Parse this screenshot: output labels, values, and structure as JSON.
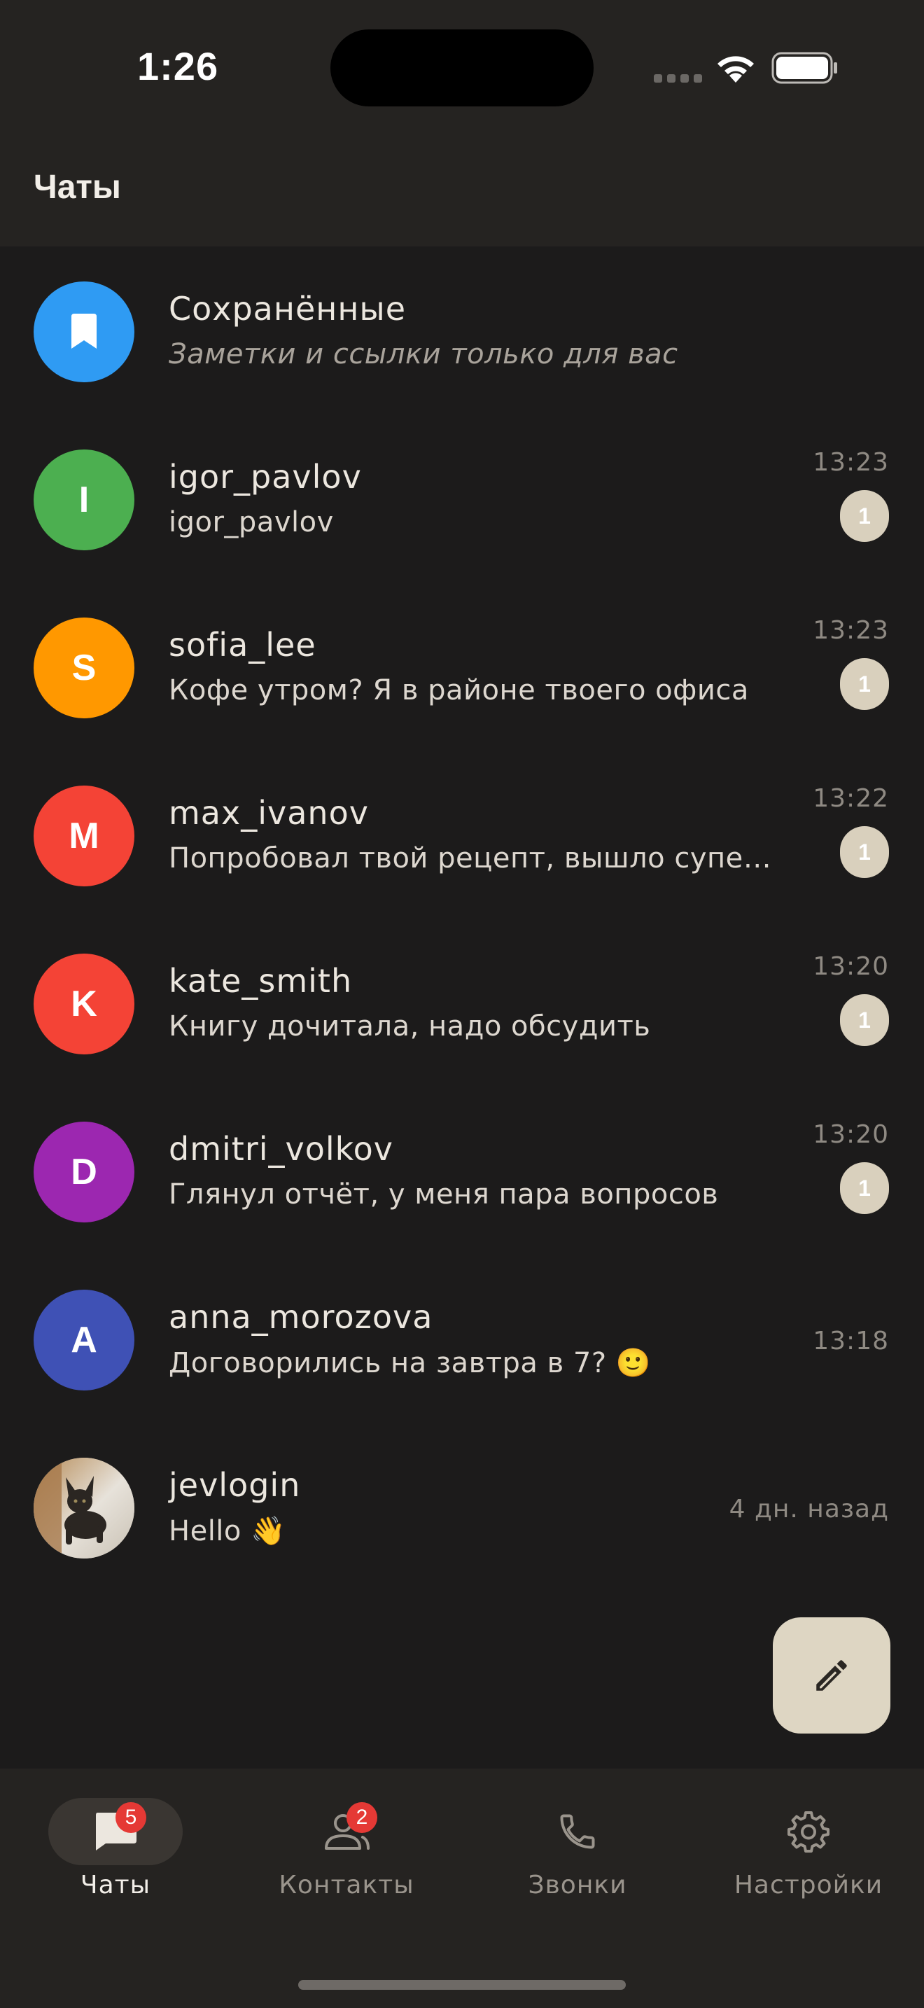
{
  "status_bar": {
    "time": "1:26"
  },
  "app_bar": {
    "title": "Чаты"
  },
  "chats": [
    {
      "name": "Сохранённые",
      "preview": "Заметки и ссылки только для вас",
      "time": "",
      "unread": "",
      "avatar": {
        "type": "icon",
        "icon": "bookmark-icon",
        "color": "#2f9bf3"
      }
    },
    {
      "name": "igor_pavlov",
      "preview": "igor_pavlov",
      "time": "13:23",
      "unread": "1",
      "avatar": {
        "type": "letter",
        "letter": "I",
        "color": "#4caf50"
      }
    },
    {
      "name": "sofia_lee",
      "preview": "Кофе утром? Я в районе твоего офиса",
      "time": "13:23",
      "unread": "1",
      "avatar": {
        "type": "letter",
        "letter": "S",
        "color": "#ff9800"
      }
    },
    {
      "name": "max_ivanov",
      "preview": "Попробовал твой рецепт, вышло супер…",
      "time": "13:22",
      "unread": "1",
      "avatar": {
        "type": "letter",
        "letter": "M",
        "color": "#f44336"
      }
    },
    {
      "name": "kate_smith",
      "preview": "Книгу дочитала, надо обсудить",
      "time": "13:20",
      "unread": "1",
      "avatar": {
        "type": "letter",
        "letter": "K",
        "color": "#f44336"
      }
    },
    {
      "name": "dmitri_volkov",
      "preview": "Глянул отчёт, у меня пара вопросов",
      "time": "13:20",
      "unread": "1",
      "avatar": {
        "type": "letter",
        "letter": "D",
        "color": "#9c27b0"
      }
    },
    {
      "name": "anna_morozova",
      "preview": "Договорились на завтра в 7? 🙂",
      "time": "13:18",
      "unread": "",
      "avatar": {
        "type": "letter",
        "letter": "A",
        "color": "#3f51b5"
      }
    },
    {
      "name": "jevlogin",
      "preview": "Hello 👋",
      "time": "4 дн. назад",
      "unread": "",
      "avatar": {
        "type": "photo",
        "icon": "cat-photo"
      }
    }
  ],
  "fab": {
    "icon": "pencil-icon"
  },
  "bottom_nav": [
    {
      "label": "Чаты",
      "icon": "chat-bubble-icon",
      "badge": "5",
      "active": true
    },
    {
      "label": "Контакты",
      "icon": "contacts-icon",
      "badge": "2",
      "active": false
    },
    {
      "label": "Звонки",
      "icon": "phone-icon",
      "badge": "",
      "active": false
    },
    {
      "label": "Настройки",
      "icon": "gear-icon",
      "badge": "",
      "active": false
    }
  ],
  "colors": {
    "background": "#1c1b1b",
    "bar": "#252321",
    "accent": "#ded6c3",
    "badge": "#e53935"
  }
}
